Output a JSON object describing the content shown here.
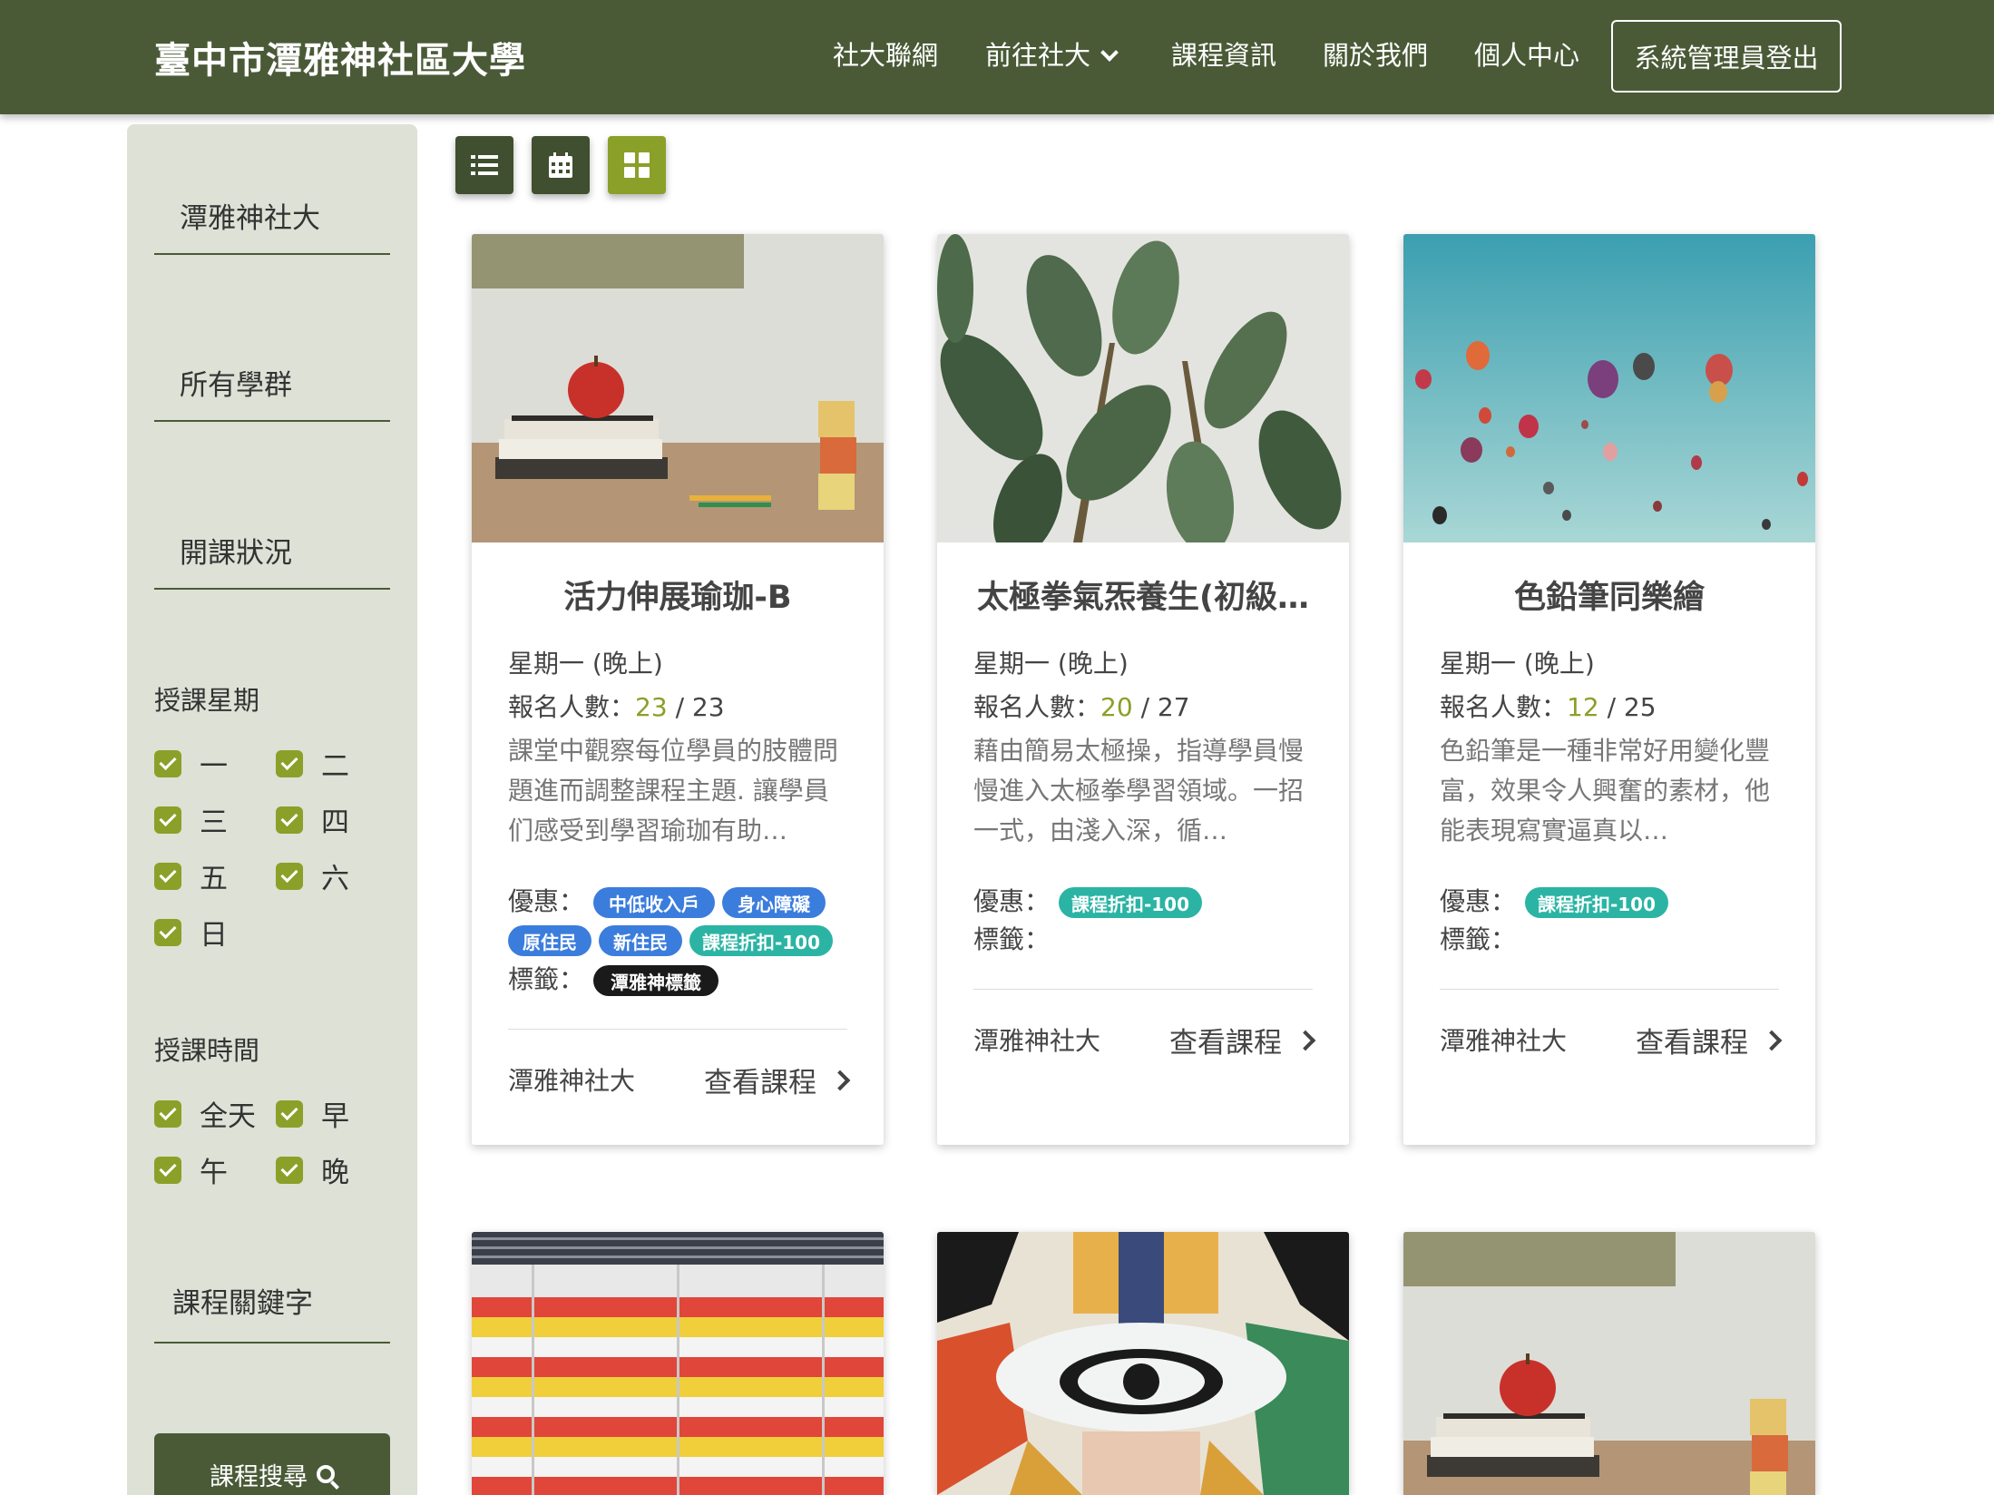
{
  "header": {
    "brand": "臺中市潭雅神社區大學",
    "nav": [
      "社大聯網",
      "前往社大",
      "課程資訊",
      "關於我們",
      "個人中心"
    ],
    "logout_label": "系統管理員登出"
  },
  "sidebar": {
    "school_select": "潭雅神社大",
    "group_select": "所有學群",
    "status_select": "開課狀況",
    "weekday_label": "授課星期",
    "weekdays": [
      "一",
      "二",
      "三",
      "四",
      "五",
      "六",
      "日"
    ],
    "time_label": "授課時間",
    "times": [
      "全天",
      "早",
      "午",
      "晚"
    ],
    "keyword_placeholder": "課程關鍵字",
    "search_label": "課程搜尋"
  },
  "view_modes": [
    "list-icon",
    "calendar-icon",
    "grid-icon"
  ],
  "labels": {
    "day_prefix": "星期一",
    "enroll_prefix": "報名人數：",
    "discount": "優惠：",
    "tags": "標籤：",
    "view_course": "查看課程"
  },
  "courses": [
    {
      "title": "活力伸展瑜珈-B",
      "schedule": "星期一 (晚上)",
      "enrolled": "23",
      "capacity": "/ 23",
      "description": "課堂中觀察每位學員的肢體問題進而調整課程主題. 讓學員们感受到學習瑜珈有助…",
      "discounts": [
        "中低收入戶",
        "身心障礙",
        "原住民",
        "新住民",
        "課程折扣-100"
      ],
      "tags": [
        "潭雅神標籤"
      ],
      "school": "潭雅神社大"
    },
    {
      "title": "太極拳氣炁養生(初級…",
      "schedule": "星期一 (晚上)",
      "enrolled": "20",
      "capacity": "/ 27",
      "description": "藉由簡易太極操，指導學員慢慢進入太極拳學習領域。一招一式，由淺入深，循…",
      "discounts": [
        "課程折扣-100"
      ],
      "tags": [],
      "school": "潭雅神社大"
    },
    {
      "title": "色鉛筆同樂繪",
      "schedule": "星期一 (晚上)",
      "enrolled": "12",
      "capacity": "/ 25",
      "description": "色鉛筆是一種非常好用變化豐富，效果令人興奮的素材，他能表現寫實逼真以…",
      "discounts": [
        "課程折扣-100"
      ],
      "tags": [],
      "school": "潭雅神社大"
    }
  ],
  "colors": {
    "header": "#4a5a37",
    "accent": "#8aa028",
    "sidebar": "#dde1d6",
    "tag_blue": "#3b7ddd",
    "tag_teal": "#2bb4a4"
  }
}
